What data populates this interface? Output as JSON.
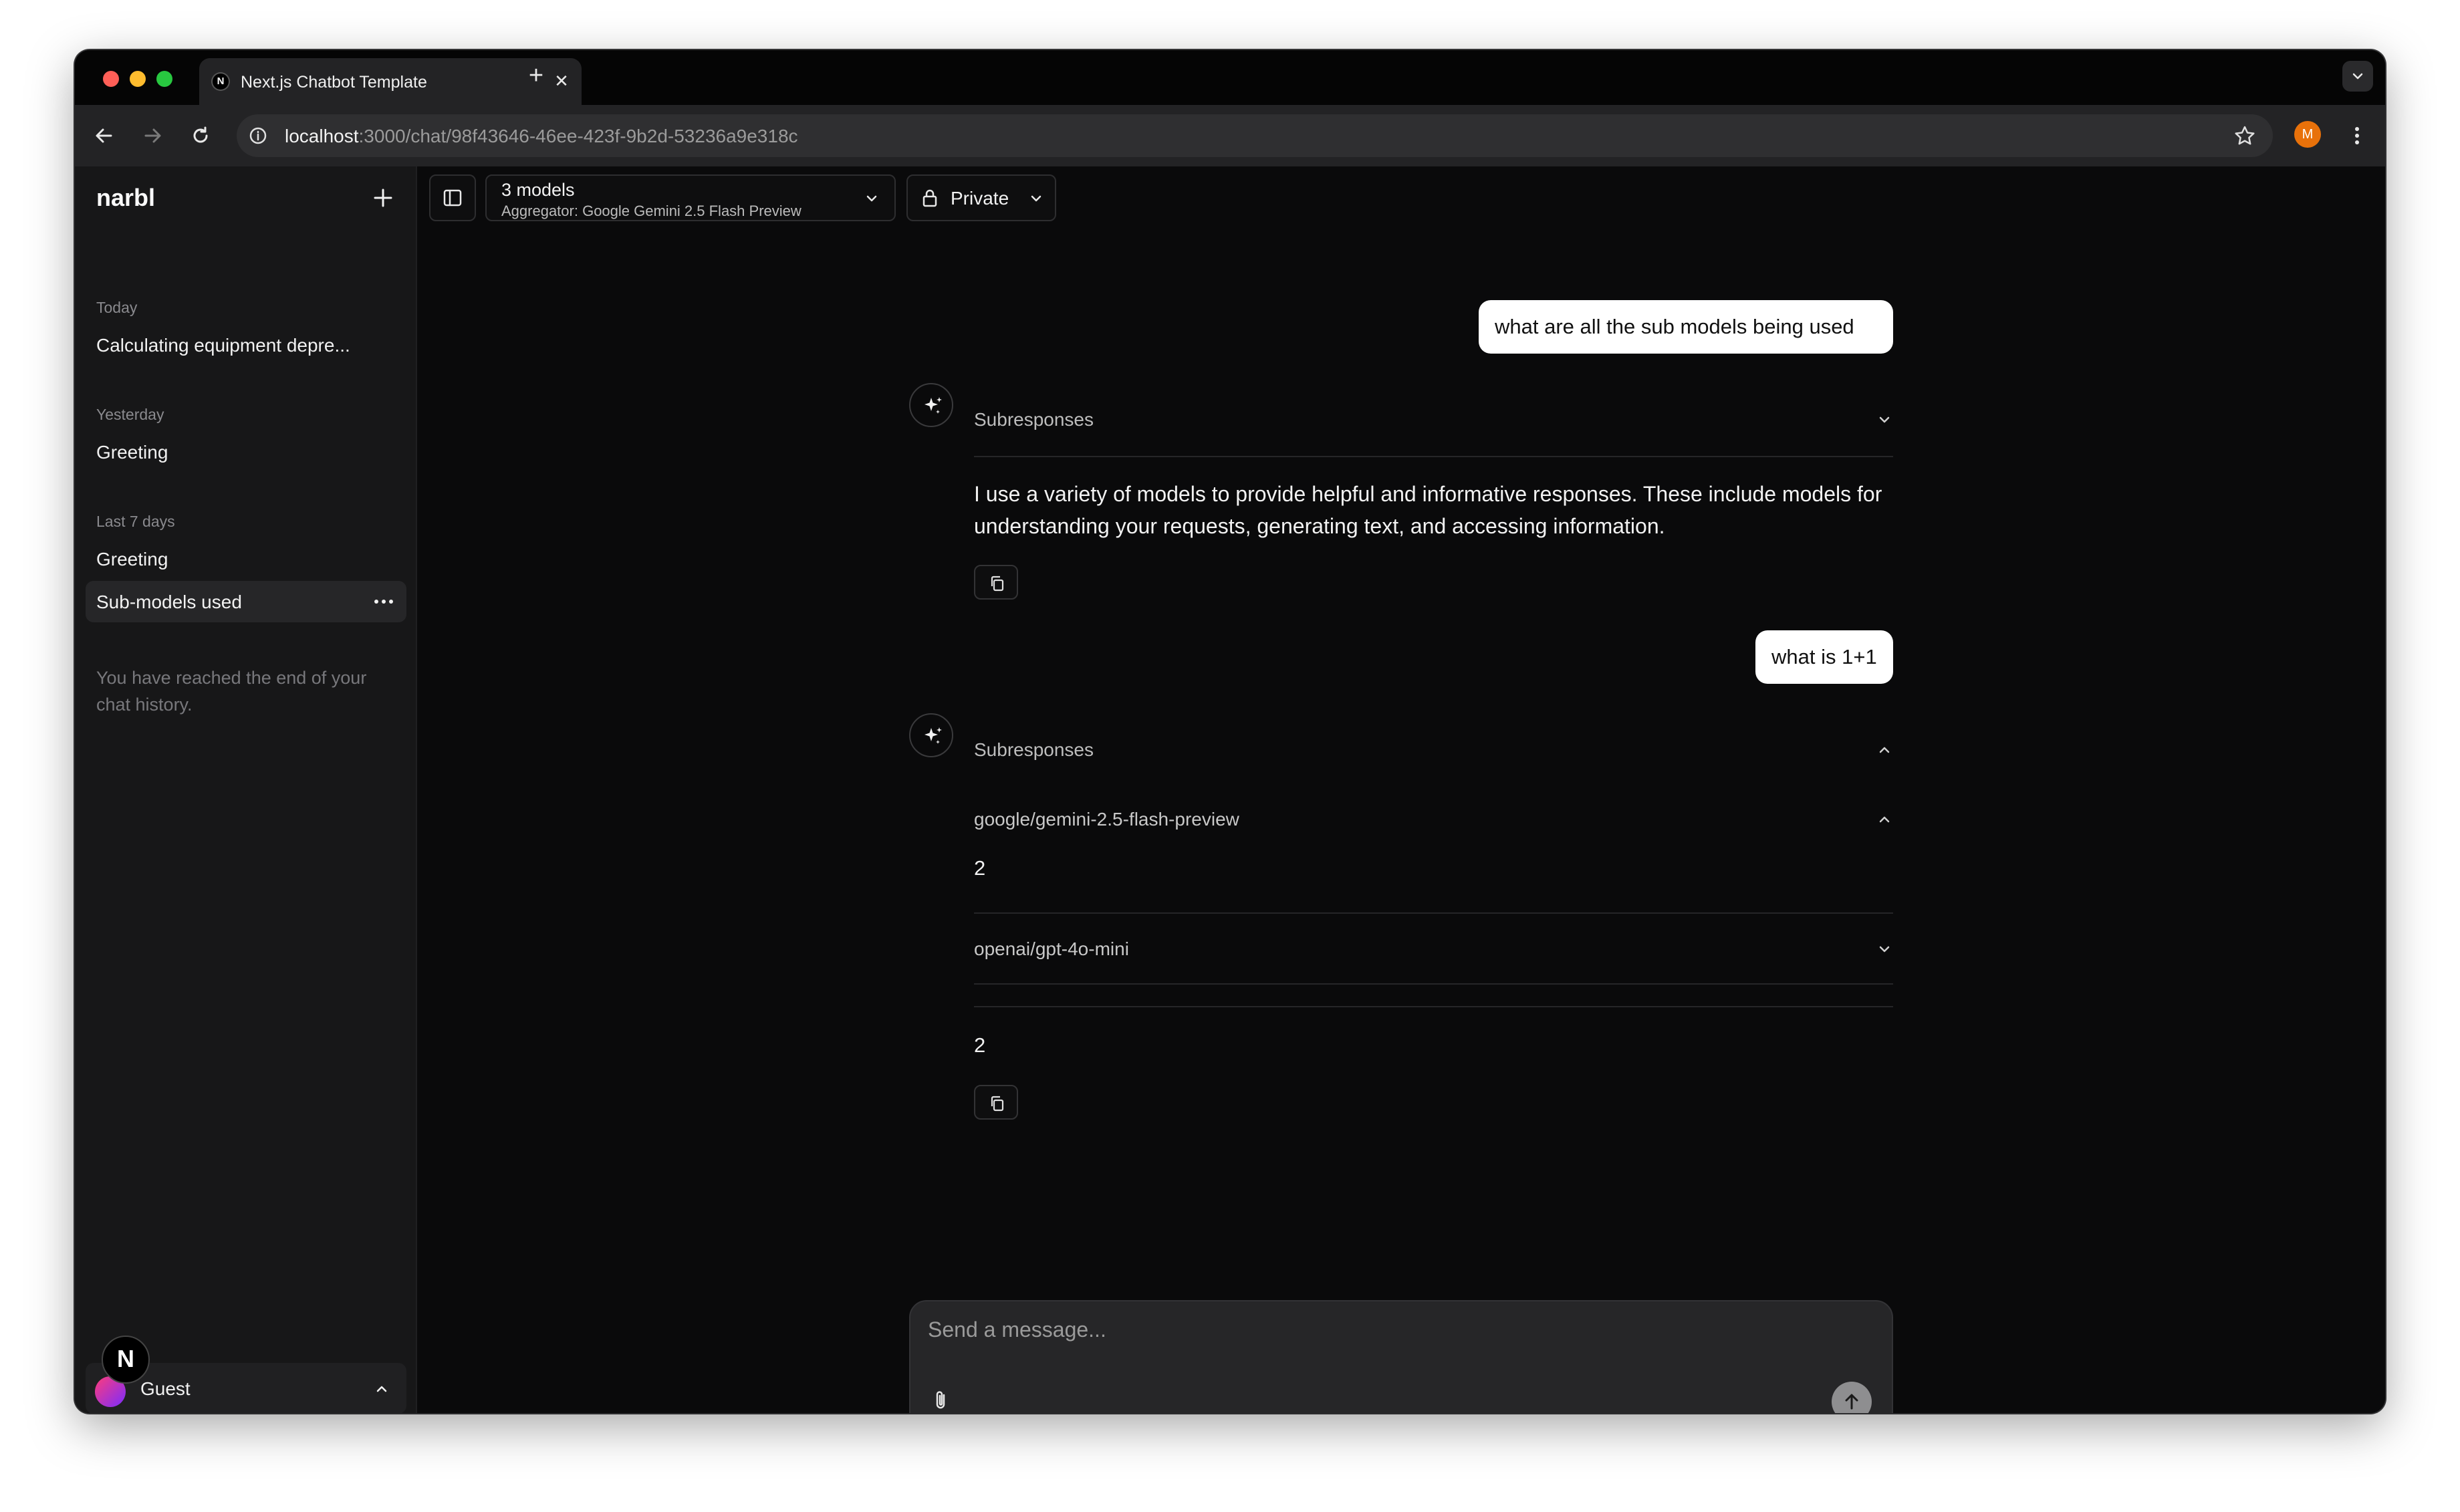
{
  "browser": {
    "tab_title": "Next.js Chatbot Template",
    "tab_favicon": "N",
    "url_host": "localhost",
    "url_path": ":3000/chat/98f43646-46ee-423f-9b2d-53236a9e318c",
    "profile_initial": "M"
  },
  "sidebar": {
    "brand": "narbl",
    "groups": [
      {
        "label": "Today",
        "items": [
          "Calculating equipment depre..."
        ]
      },
      {
        "label": "Yesterday",
        "items": [
          "Greeting"
        ]
      },
      {
        "label": "Last 7 days",
        "items": [
          "Greeting",
          "Sub-models used"
        ]
      }
    ],
    "end_note": "You have reached the end of your chat history.",
    "user_name": "Guest",
    "badge": "N"
  },
  "header": {
    "model_title": "3 models",
    "model_subtitle": "Aggregator: Google Gemini 2.5 Flash Preview",
    "visibility": "Private"
  },
  "messages": {
    "user_1": "what are all the sub models being used",
    "subresponses_1": "Subresponses",
    "assistant_1": "I use a variety of models to provide helpful and informative responses. These include models for understanding your requests, generating text, and accessing information.",
    "user_2": "what is 1+1",
    "subresponses_2": "Subresponses",
    "sub_models": [
      {
        "name": "google/gemini-2.5-flash-preview",
        "answer": "2",
        "expanded": true
      },
      {
        "name": "openai/gpt-4o-mini",
        "expanded": false
      }
    ],
    "assistant_2": "2"
  },
  "composer": {
    "placeholder": "Send a message..."
  },
  "colors": {
    "background": "#0a0a0b",
    "sidebar": "#171718",
    "user_bubble": "#ffffff",
    "profile_badge": "#e8710a"
  }
}
